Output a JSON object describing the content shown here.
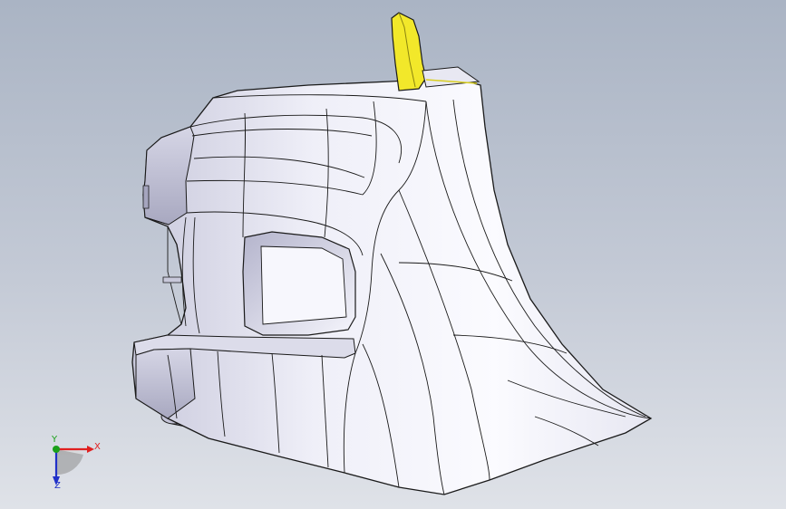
{
  "viewport": {
    "background_top": "#aab4c4",
    "background_bottom": "#dfe2e8"
  },
  "model": {
    "body_color": "#f2f2fa",
    "shade_color": "#c9c9dc",
    "edge_color": "#1a1a1a",
    "highlight_color": "#f2e82a"
  },
  "triad": {
    "x_label": "X",
    "y_label": "Y",
    "z_label": "Z",
    "x_color": "#e02020",
    "y_color": "#1aa01a",
    "z_color": "#2030c8"
  }
}
